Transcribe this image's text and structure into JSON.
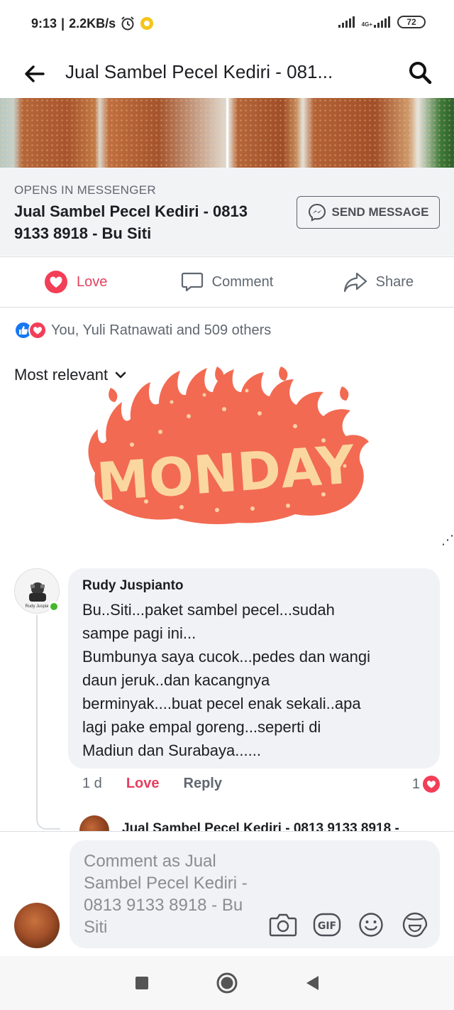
{
  "status_bar": {
    "time": "9:13",
    "speed": "2.2KB/s",
    "network_label": "4G+",
    "battery": "72"
  },
  "header": {
    "title": "Jual Sambel Pecel Kediri - 081..."
  },
  "messenger": {
    "opens_label": "OPENS IN MESSENGER",
    "page_name": "Jual Sambel Pecel Kediri - 0813 9133 8918 - Bu Siti",
    "send_button": "SEND MESSAGE"
  },
  "actions": {
    "love": "Love",
    "comment": "Comment",
    "share": "Share"
  },
  "reactions": {
    "summary": "You, Yuli Ratnawati and 509 others"
  },
  "sort": {
    "label": "Most relevant"
  },
  "sticker": {
    "text": "MONDAY"
  },
  "comment": {
    "author": "Rudy Juspianto",
    "avatar_caption": "Rudy Juspia",
    "text": "Bu..Siti...paket sambel pecel...sudah\nsampe pagi ini...\nBumbunya saya cucok...pedes dan wangi\ndaun jeruk..dan kacangnya\nberminyak....buat pecel enak sekali..apa\nlagi pake empal goreng...seperti di\nMadiun dan Surabaya......",
    "time": "1 d",
    "love": "Love",
    "reply": "Reply",
    "reaction_count": "1"
  },
  "reply_preview": {
    "name": "Jual Sambel Pecel Kediri - 0813 9133 8918 -"
  },
  "composer": {
    "placeholder": "Comment as Jual Sambel Pecel Kediri - 0813 9133 8918 - Bu Siti"
  },
  "colors": {
    "love_red": "#e4405f",
    "like_blue": "#1877f2",
    "flame": "#f26a52",
    "monday_text": "#fbd7a0"
  }
}
